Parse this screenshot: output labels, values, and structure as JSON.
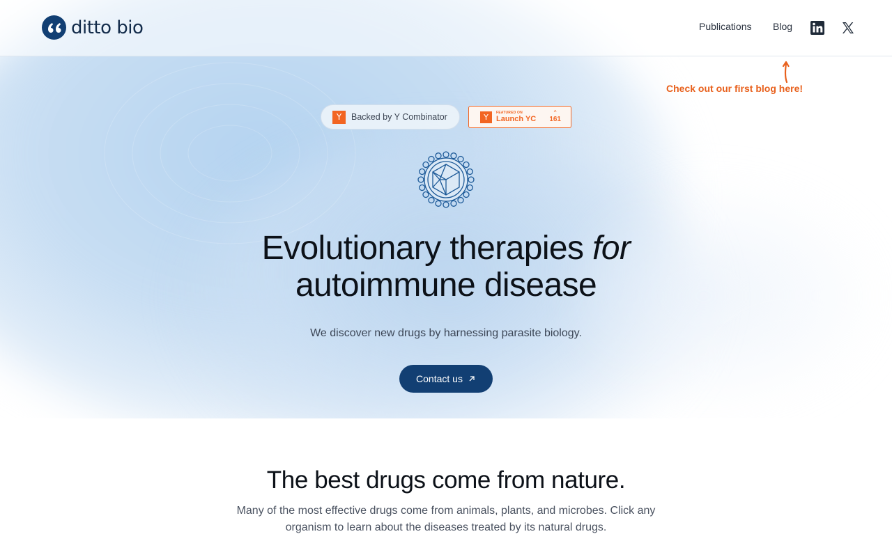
{
  "brand": {
    "name": "ditto bio"
  },
  "nav": {
    "publications": "Publications",
    "blog": "Blog",
    "icons": [
      "linkedin-icon",
      "x-twitter-icon"
    ]
  },
  "blog_callout": {
    "text": "Check out our first blog here!"
  },
  "badges": {
    "yc_pill": {
      "icon": "Y",
      "label": "Backed by Y Combinator"
    },
    "launch": {
      "icon": "Y",
      "small": "FEATURED ON",
      "big": "Launch YC",
      "count": "161"
    }
  },
  "hero": {
    "title_line1_a": "Evolutionary therapies ",
    "title_line1_b": "for",
    "title_line2": "autoimmune disease",
    "subtitle": "We discover new drugs by harnessing parasite biology.",
    "cta": "Contact us"
  },
  "section": {
    "title": "The best drugs come from nature.",
    "body": "Many of the most effective drugs come from animals, plants, and microbes. Click any organism to learn about the diseases treated by its natural drugs."
  },
  "colors": {
    "navy": "#123f73",
    "orange": "#f26522",
    "callout": "#e8601c"
  }
}
